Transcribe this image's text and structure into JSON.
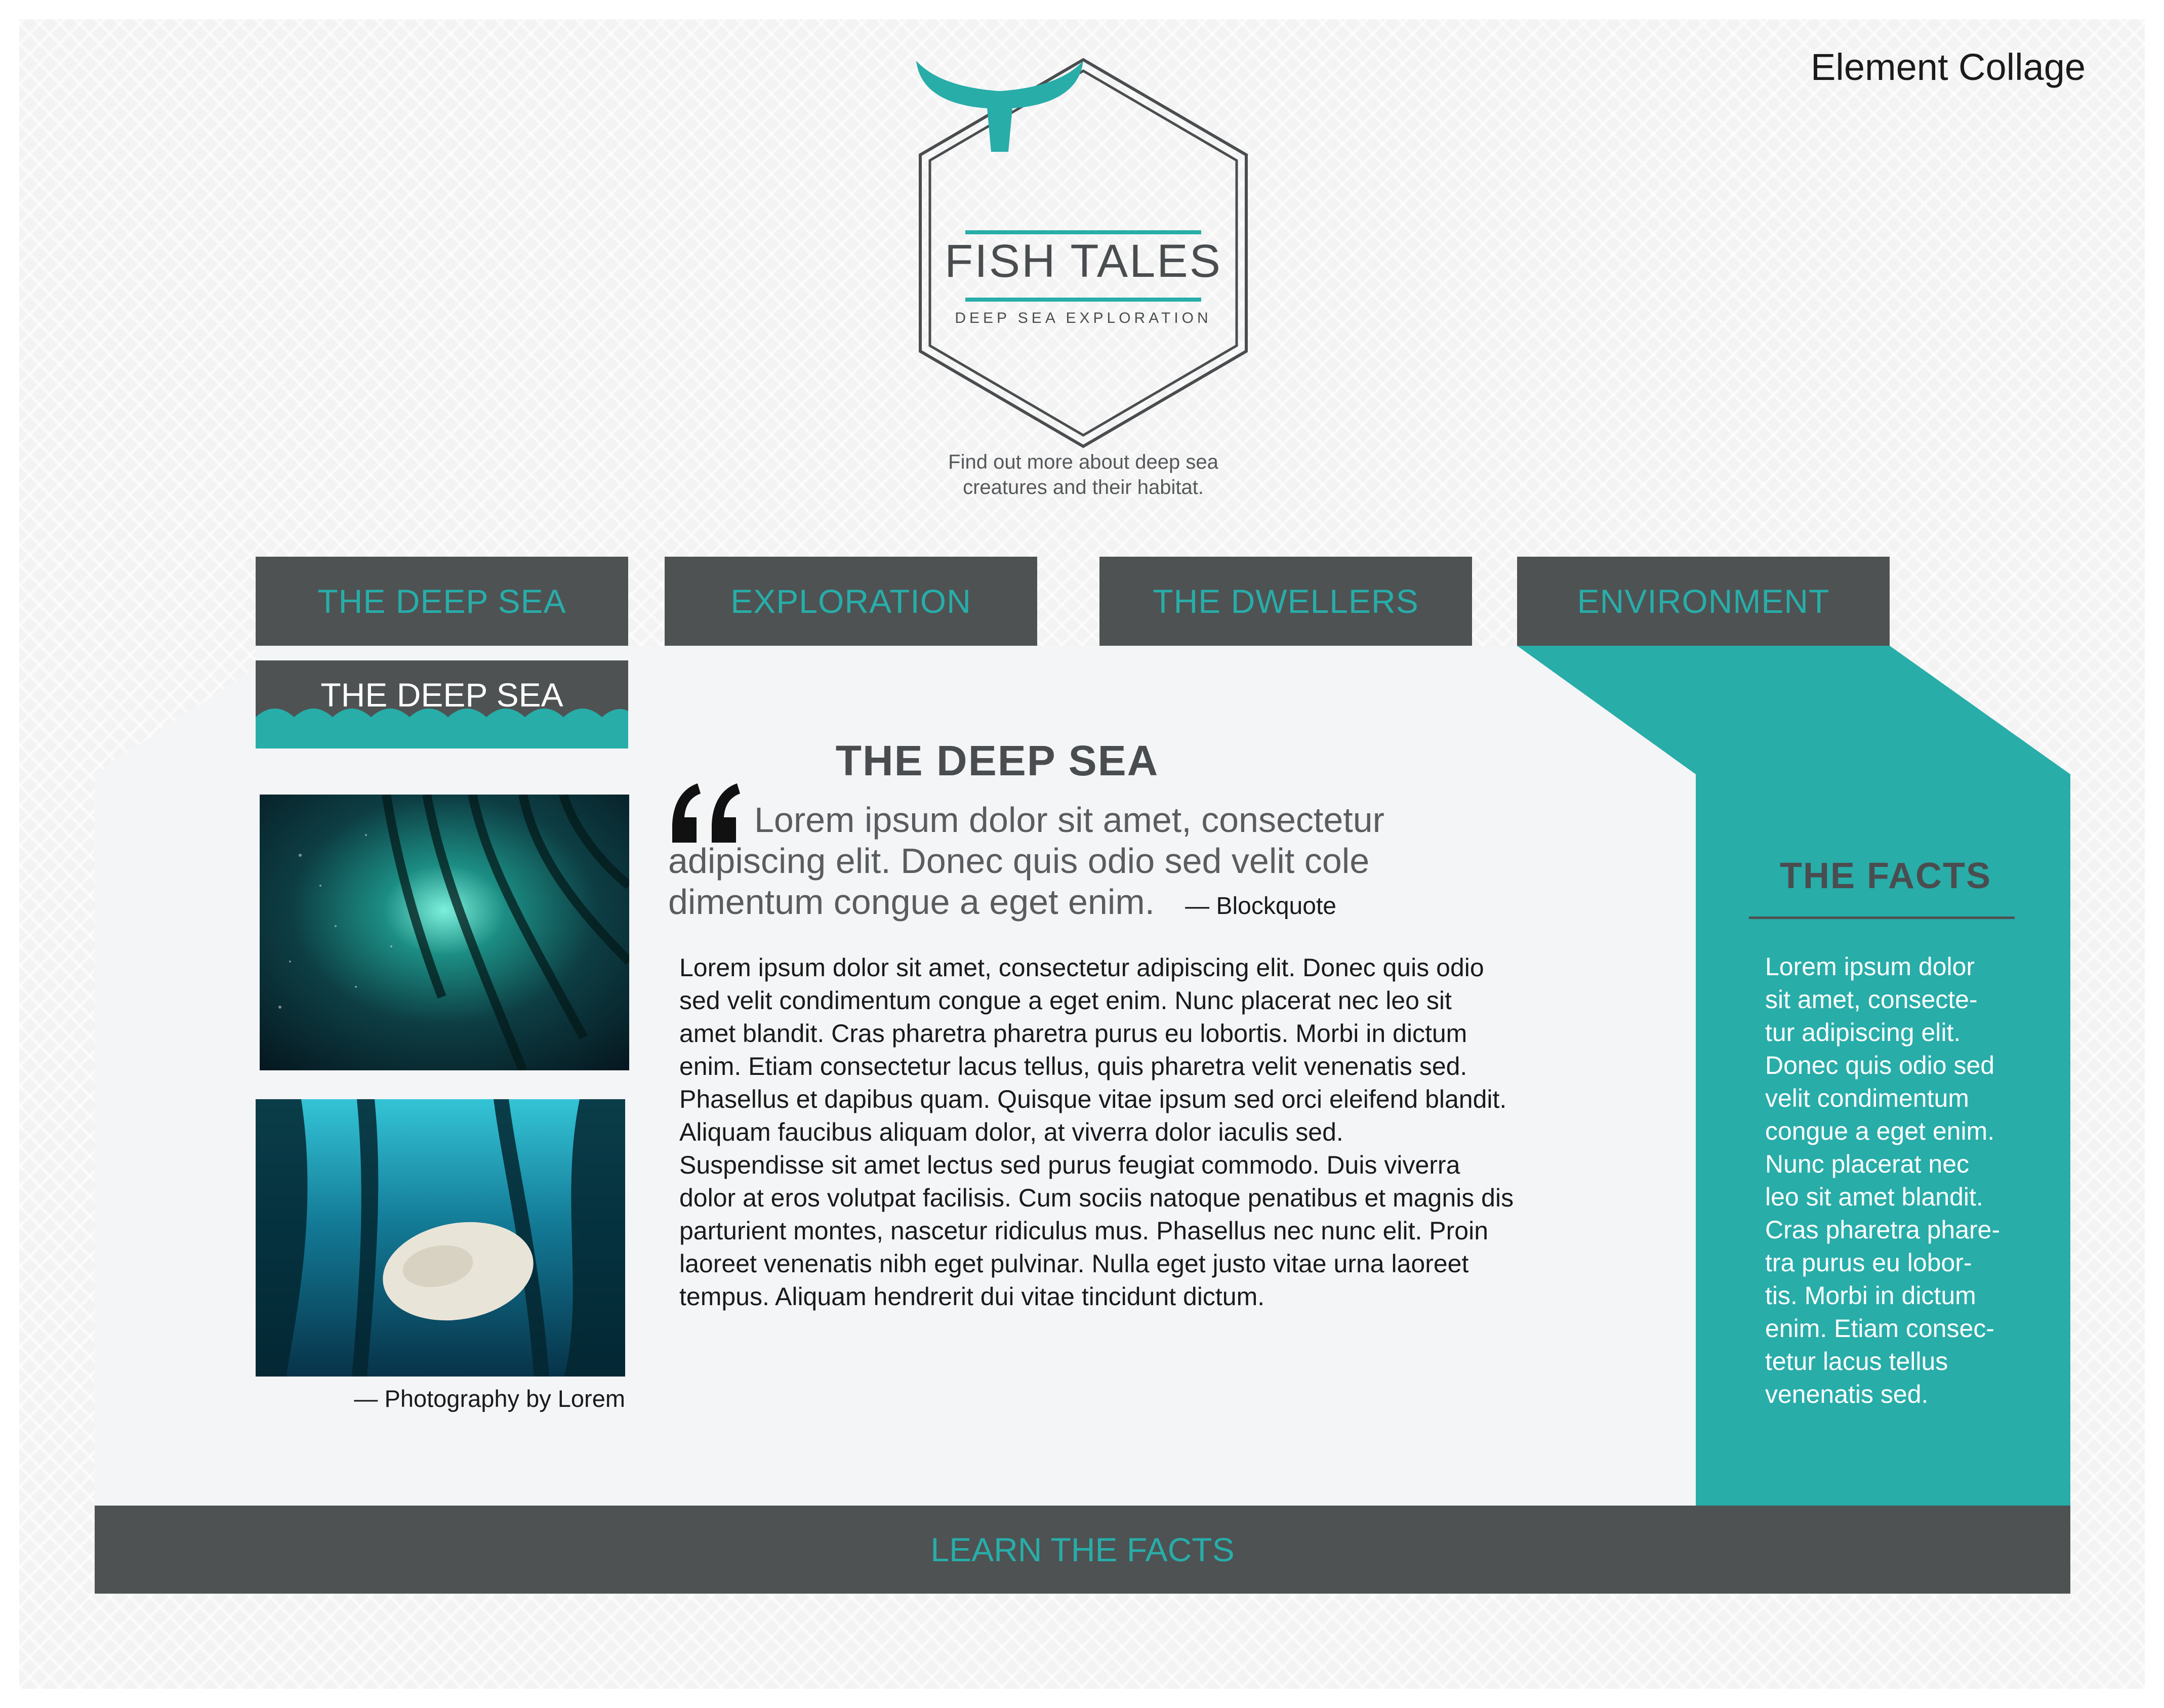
{
  "page": {
    "collage_label": "Element Collage"
  },
  "logo": {
    "title": "FISH TALES",
    "subtitle": "DEEP SEA EXPLORATION",
    "icon": "whale-tail-icon",
    "tagline_line1": "Find out more about deep sea",
    "tagline_line2": "creatures and their habitat."
  },
  "nav": {
    "items": [
      "THE DEEP SEA",
      "EXPLORATION",
      "THE DWELLERS",
      "ENVIRONMENT"
    ]
  },
  "main": {
    "active_tab": "THE DEEP SEA",
    "title": "THE DEEP SEA",
    "blockquote": {
      "text": "Lorem ipsum dolor sit amet, consectetur adipiscing elit. Donec quis odio sed velit cole dimentum congue a eget enim.",
      "source": "— Blockquote"
    },
    "body_p1": "Lorem ipsum dolor sit amet, consectetur adipiscing elit. Donec quis odio sed velit condimentum congue a eget enim. Nunc placerat nec leo sit amet blandit. Cras pharetra pharetra purus eu lobortis. Morbi in dictum enim. Etiam consectetur lacus tellus, quis pharetra velit venenatis sed. Phasellus et dapibus quam. Quisque vitae ipsum sed orci eleifend blandit. Aliquam faucibus aliquam dolor, at viverra dolor iaculis sed.",
    "body_p2": "Suspendisse sit amet lectus sed purus feugiat commodo. Duis viverra dolor at eros volutpat facilisis. Cum sociis natoque penatibus et magnis dis parturient montes, nascetur ridiculus mus. Phasellus nec nunc elit. Proin laoreet venenatis nibh eget pulvinar. Nulla eget justo vitae urna laoreet tempus. Aliquam hendrerit dui vitae tincidunt dictum.",
    "photo_credit": "— Photography by Lorem"
  },
  "facts": {
    "title": "THE FACTS",
    "text": "Lorem ipsum dolor\nsit amet, consecte-\ntur adipiscing elit.\nDonec quis odio sed\nvelit condimentum\ncongue a eget enim.\nNunc placerat nec\nleo sit amet blandit.\nCras pharetra phare-\ntra purus eu lobor-\ntis. Morbi in dictum\nenim. Etiam consec-\ntetur lacus tellus\nvenenatis sed."
  },
  "footer": {
    "cta": "LEARN THE FACTS"
  },
  "colors": {
    "teal": "#28ada9",
    "charcoal": "#4e5253",
    "panel": "#f4f5f7",
    "text_dark": "#4a4d4f"
  }
}
